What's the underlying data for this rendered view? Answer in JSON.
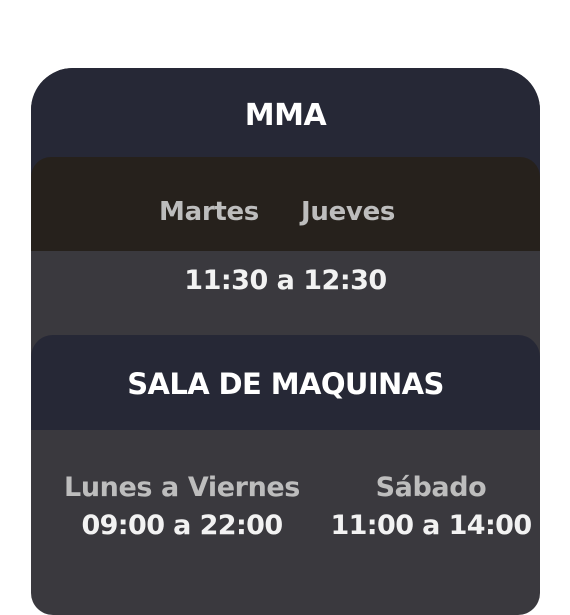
{
  "mma": {
    "title": "MMA",
    "days": [
      "Martes",
      "Jueves"
    ],
    "time": "11:30 a 12:30"
  },
  "sala": {
    "title": "SALA DE MAQUINAS",
    "schedule": [
      {
        "days": "Lunes a Viernes",
        "time": "09:00 a 22:00"
      },
      {
        "days": "Sábado",
        "time": "11:00 a 14:00"
      }
    ]
  },
  "colors": {
    "header_navy": "#262836",
    "days_band": "#26211c",
    "card_body": "#3a393e",
    "title_text": "#ffffff",
    "muted_text": "#bdbdbd"
  }
}
